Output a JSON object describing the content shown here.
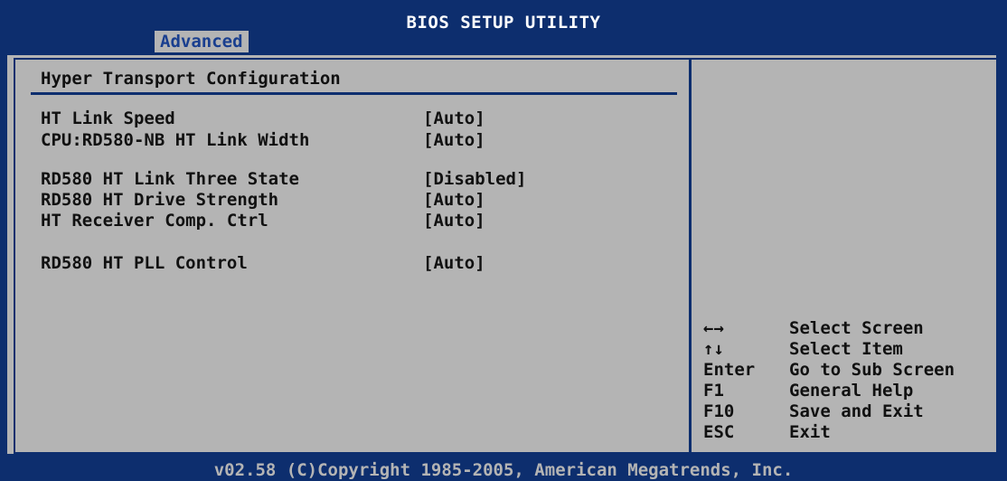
{
  "window": {
    "title": "BIOS SETUP UTILITY"
  },
  "tabs": [
    {
      "label": "Advanced",
      "active": true
    }
  ],
  "section": {
    "title": "Hyper Transport Configuration"
  },
  "settings": [
    {
      "label": "HT Link Speed",
      "value": "[Auto]"
    },
    {
      "label": "CPU:RD580-NB HT Link Width",
      "value": "[Auto]"
    },
    {
      "label": "RD580 HT Link Three State",
      "value": "[Disabled]"
    },
    {
      "label": "RD580 HT Drive Strength",
      "value": "[Auto]"
    },
    {
      "label": "HT Receiver Comp. Ctrl",
      "value": "[Auto]"
    },
    {
      "label": "RD580 HT PLL Control",
      "value": "[Auto]"
    }
  ],
  "help": [
    {
      "key": "←→",
      "icon": "left-right-arrows-icon",
      "desc": "Select Screen"
    },
    {
      "key": "↑↓",
      "icon": "up-down-arrows-icon",
      "desc": "Select Item"
    },
    {
      "key": "Enter",
      "desc": "Go to Sub Screen"
    },
    {
      "key": "F1",
      "desc": "General Help"
    },
    {
      "key": "F10",
      "desc": "Save and Exit"
    },
    {
      "key": "ESC",
      "desc": "Exit"
    }
  ],
  "footer": {
    "text": "v02.58 (C)Copyright 1985-2005, American Megatrends, Inc."
  },
  "colors": {
    "background": "#0d2e6e",
    "panel": "#b4b4b4",
    "tab_text": "#1a3f8f",
    "text": "#111111",
    "title_text": "#ffffff"
  }
}
